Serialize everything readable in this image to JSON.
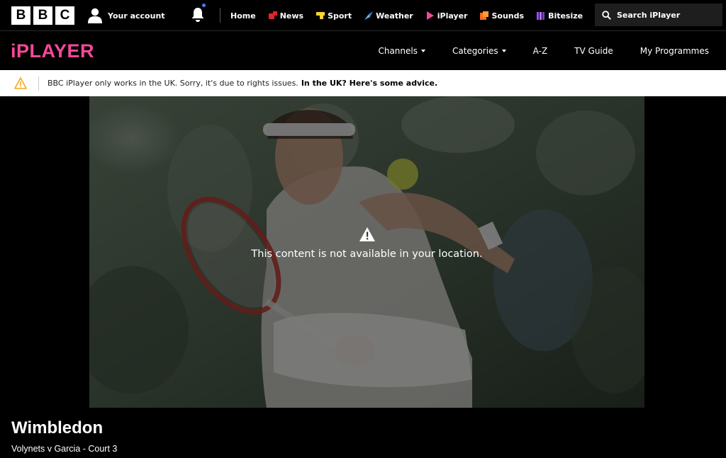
{
  "global_nav": {
    "logo_letters": [
      "B",
      "B",
      "C"
    ],
    "account_label": "Your account",
    "links": [
      {
        "label": "Home",
        "icon": "home",
        "color": ""
      },
      {
        "label": "News",
        "icon": "news-icon",
        "color": "#e0242b"
      },
      {
        "label": "Sport",
        "icon": "sport-icon",
        "color": "#ffd230"
      },
      {
        "label": "Weather",
        "icon": "weather-icon",
        "color": "#5ab1e8"
      },
      {
        "label": "iPlayer",
        "icon": "iplayer-icon",
        "color": "#f54997"
      },
      {
        "label": "Sounds",
        "icon": "sounds-icon",
        "color": "#ff6b1a"
      },
      {
        "label": "Bitesize",
        "icon": "bitesize-icon",
        "color": "#9b4dff"
      }
    ],
    "more_label": "•••",
    "search_label": "Search iPlayer"
  },
  "iplayer": {
    "logo": "iPLAYER",
    "brand_color": "#f54997",
    "menu": [
      {
        "label": "Channels",
        "dropdown": true
      },
      {
        "label": "Categories",
        "dropdown": true
      },
      {
        "label": "A-Z",
        "dropdown": false
      },
      {
        "label": "TV Guide",
        "dropdown": false
      },
      {
        "label": "My Programmes",
        "dropdown": false
      }
    ]
  },
  "banner": {
    "message": "BBC iPlayer only works in the UK. Sorry, it's due to rights issues.",
    "advice_link": "In the UK? Here's some advice.",
    "icon_color": "#f5a623"
  },
  "player": {
    "message": "This content is not available in your location."
  },
  "programme": {
    "title": "Wimbledon",
    "subtitle": "Volynets v Garcia - Court 3"
  }
}
